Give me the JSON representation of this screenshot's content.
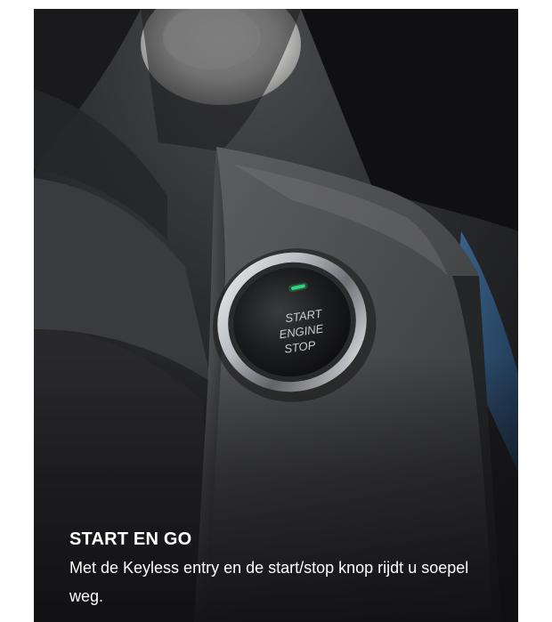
{
  "caption": {
    "title": "START EN GO",
    "text": "Met de Keyless entry en de start/stop knop rijdt u soepel weg."
  },
  "button_engraving": [
    "START",
    "ENGINE",
    "STOP"
  ],
  "colors": {
    "indicator_light": "#2fd37a",
    "caption_text": "#ffffff"
  }
}
